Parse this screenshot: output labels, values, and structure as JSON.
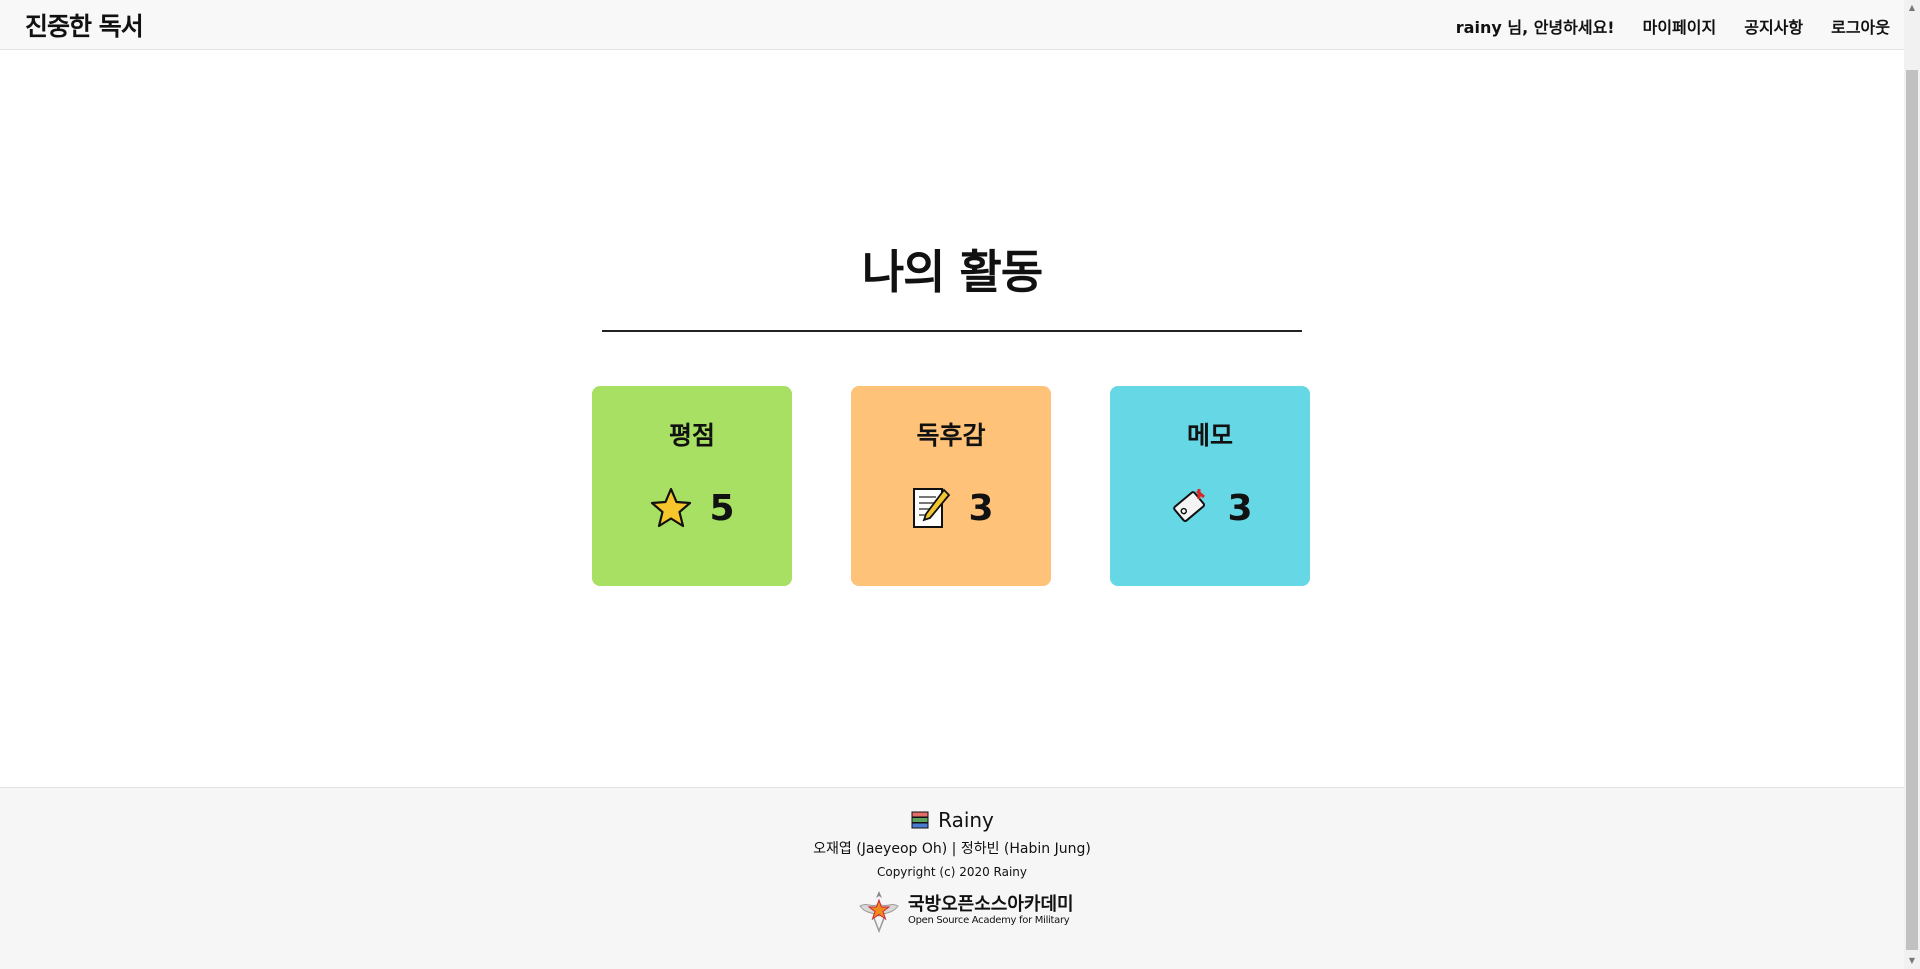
{
  "nav": {
    "brand": "진중한 독서",
    "greeting": "rainy 님, 안녕하세요!",
    "links": [
      "마이페이지",
      "공지사항",
      "로그아웃"
    ]
  },
  "main": {
    "title": "나의 활동",
    "cards": [
      {
        "title": "평점",
        "count": "5",
        "icon": "star-icon",
        "color": "#a8e063"
      },
      {
        "title": "독후감",
        "count": "3",
        "icon": "memo-icon",
        "color": "#fec278"
      },
      {
        "title": "메모",
        "count": "3",
        "icon": "bookmark-icon",
        "color": "#66d7e5"
      }
    ]
  },
  "footer": {
    "brand": "Rainy",
    "authors": "오재엽 (Jaeyeop Oh) | 정하빈 (Habin Jung)",
    "copyright": "Copyright (c) 2020 Rainy",
    "academy_ko": "국방오픈소스아카데미",
    "academy_en": "Open Source Academy for Military"
  }
}
